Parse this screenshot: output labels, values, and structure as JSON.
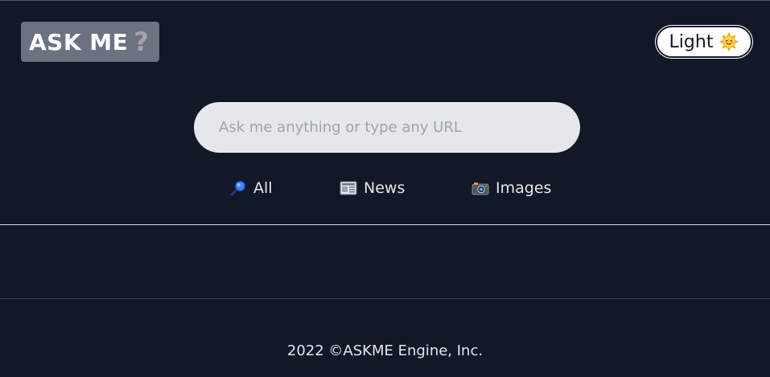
{
  "header": {
    "logo_text": "ASK ME",
    "logo_mark": "?",
    "theme_toggle_label": "Light",
    "theme_toggle_icon": "smiling-sun-icon"
  },
  "search": {
    "placeholder": "Ask me anything or type any URL",
    "value": ""
  },
  "tabs": [
    {
      "label": "All",
      "icon": "magnifying-glass-icon"
    },
    {
      "label": "News",
      "icon": "newspaper-icon"
    },
    {
      "label": "Images",
      "icon": "camera-icon"
    }
  ],
  "footer": {
    "text": "2022 ©ASKME Engine, Inc."
  },
  "colors": {
    "background": "#111827",
    "logo_bg": "#6b7280",
    "search_bg": "#e5e7eb",
    "text": "#e5e7eb"
  }
}
